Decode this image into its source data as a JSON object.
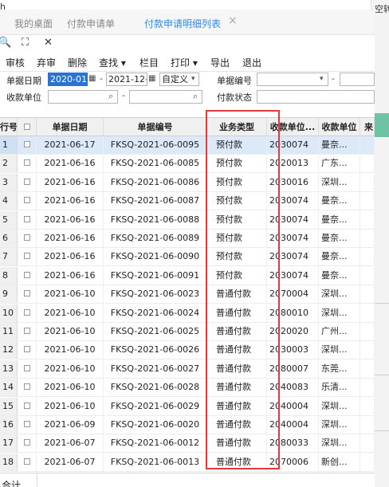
{
  "background": {
    "top_right_text": "空转",
    "top_left_text": "h"
  },
  "tabs": [
    {
      "label": "我的桌面",
      "active": false
    },
    {
      "label": "付款申请单",
      "active": false
    },
    {
      "label": "付款申请明细列表",
      "active": true
    }
  ],
  "tab_close": "×",
  "icon_row": {
    "search": "🔍",
    "expand": "⛶",
    "close": "✕"
  },
  "toolbar": {
    "audit": "审核",
    "abandon": "弃审",
    "delete": "删除",
    "query": "查找",
    "column": "栏目",
    "print": "打印",
    "export": "导出",
    "exit": "退出"
  },
  "filters": {
    "date_label": "单据日期",
    "date_from": "2020-01",
    "date_to": "2021-12-",
    "date_mode": "自定义",
    "code_label": "单据编号",
    "code_from": "",
    "code_to": "",
    "unit_label": "收款单位",
    "unit_from": "",
    "unit_to": "",
    "status_label": "付款状态",
    "status_value": ""
  },
  "grid": {
    "columns": {
      "num": "行号",
      "date": "单据日期",
      "code": "单据编号",
      "type": "业务类型",
      "unit": "收款单位...",
      "name": "收款单位",
      "extra": "来"
    },
    "rows": [
      {
        "num": "1",
        "date": "2021-06-17",
        "code": "FKSQ-2021-06-0095",
        "type": "预付款",
        "unit": "2030074",
        "name": "曼奈..."
      },
      {
        "num": "2",
        "date": "2021-06-16",
        "code": "FKSQ-2021-06-0085",
        "type": "预付款",
        "unit": "2020013",
        "name": "广东..."
      },
      {
        "num": "3",
        "date": "2021-06-16",
        "code": "FKSQ-2021-06-0086",
        "type": "预付款",
        "unit": "2030016",
        "name": "深圳..."
      },
      {
        "num": "4",
        "date": "2021-06-16",
        "code": "FKSQ-2021-06-0087",
        "type": "预付款",
        "unit": "2030074",
        "name": "曼奈..."
      },
      {
        "num": "5",
        "date": "2021-06-16",
        "code": "FKSQ-2021-06-0088",
        "type": "预付款",
        "unit": "2030074",
        "name": "曼奈..."
      },
      {
        "num": "6",
        "date": "2021-06-16",
        "code": "FKSQ-2021-06-0089",
        "type": "预付款",
        "unit": "2030074",
        "name": "曼奈..."
      },
      {
        "num": "7",
        "date": "2021-06-16",
        "code": "FKSQ-2021-06-0090",
        "type": "预付款",
        "unit": "2030074",
        "name": "曼奈..."
      },
      {
        "num": "8",
        "date": "2021-06-16",
        "code": "FKSQ-2021-06-0091",
        "type": "预付款",
        "unit": "2030074",
        "name": "曼奈..."
      },
      {
        "num": "9",
        "date": "2021-06-10",
        "code": "FKSQ-2021-06-0023",
        "type": "普通付款",
        "unit": "2070004",
        "name": "深圳..."
      },
      {
        "num": "10",
        "date": "2021-06-10",
        "code": "FKSQ-2021-06-0024",
        "type": "普通付款",
        "unit": "2080010",
        "name": "深圳..."
      },
      {
        "num": "11",
        "date": "2021-06-10",
        "code": "FKSQ-2021-06-0025",
        "type": "普通付款",
        "unit": "2020020",
        "name": "广州..."
      },
      {
        "num": "12",
        "date": "2021-06-10",
        "code": "FKSQ-2021-06-0026",
        "type": "普通付款",
        "unit": "2030003",
        "name": "深圳..."
      },
      {
        "num": "13",
        "date": "2021-06-10",
        "code": "FKSQ-2021-06-0027",
        "type": "普通付款",
        "unit": "2080007",
        "name": "东莞..."
      },
      {
        "num": "14",
        "date": "2021-06-10",
        "code": "FKSQ-2021-06-0028",
        "type": "普通付款",
        "unit": "2040083",
        "name": "乐清..."
      },
      {
        "num": "15",
        "date": "2021-06-10",
        "code": "FKSQ-2021-06-0029",
        "type": "普通付款",
        "unit": "2040004",
        "name": "深圳..."
      },
      {
        "num": "16",
        "date": "2021-06-09",
        "code": "FKSQ-2021-06-0020",
        "type": "普通付款",
        "unit": "2040004",
        "name": "深圳..."
      },
      {
        "num": "17",
        "date": "2021-06-07",
        "code": "FKSQ-2021-06-0012",
        "type": "普通付款",
        "unit": "2080033",
        "name": "深圳..."
      },
      {
        "num": "18",
        "date": "2021-06-07",
        "code": "FKSQ-2021-06-0013",
        "type": "普通付款",
        "unit": "2070006",
        "name": "新创..."
      }
    ]
  },
  "footer": {
    "sum_label": "合计"
  },
  "colors": {
    "accent": "#2d8ce8",
    "selected_row": "#dbe9f8",
    "highlight_box": "#e23a3a",
    "teal": "#6fc3a5"
  }
}
